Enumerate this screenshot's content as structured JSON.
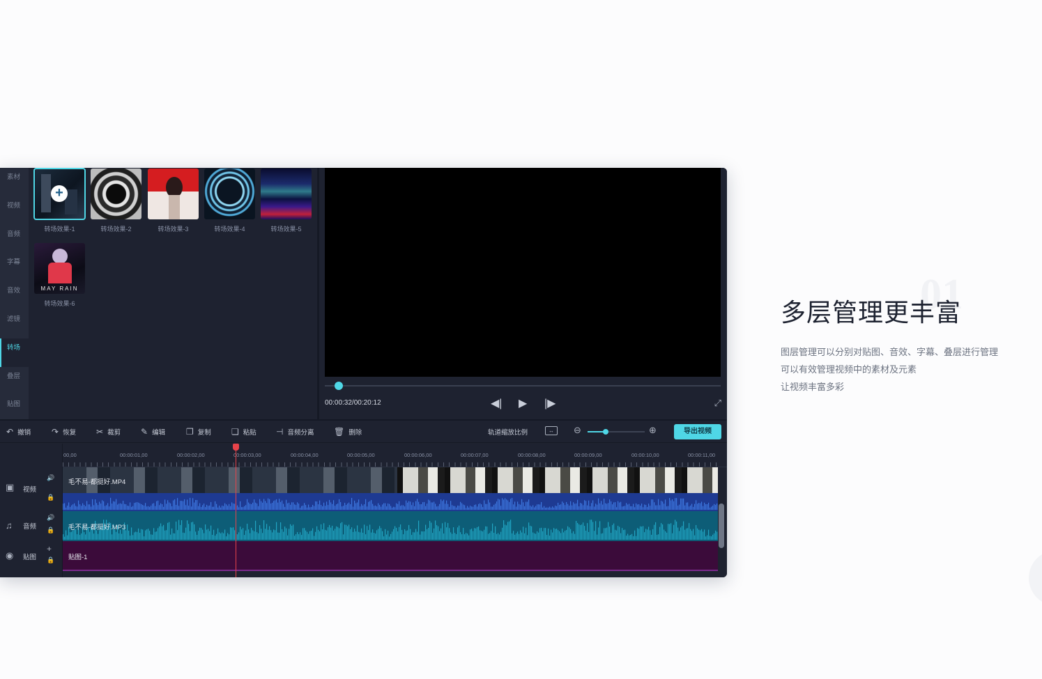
{
  "sidebar": {
    "items": [
      {
        "label": "素材"
      },
      {
        "label": "视频"
      },
      {
        "label": "音频"
      },
      {
        "label": "字幕"
      },
      {
        "label": "音效"
      },
      {
        "label": "滤镜"
      },
      {
        "label": "转场",
        "active": true
      },
      {
        "label": "叠层"
      },
      {
        "label": "贴图"
      }
    ]
  },
  "library": {
    "items": [
      {
        "label": "转场效果-1",
        "selected": true
      },
      {
        "label": "转场效果-2"
      },
      {
        "label": "转场效果-3"
      },
      {
        "label": "转场效果-4"
      },
      {
        "label": "转场效果-5"
      },
      {
        "label": "转场效果-6",
        "image_text": "MAY RAIN"
      }
    ],
    "add_icon": "plus-circle-icon"
  },
  "preview": {
    "time": "00:00:32/00:20:12",
    "progress_fraction": 0.026,
    "controls": {
      "prev": "◀|",
      "play": "▶",
      "next": "|▶",
      "fullscreen": "⤢"
    }
  },
  "toolbar": {
    "undo": "撤销",
    "redo": "恢复",
    "cut": "裁剪",
    "edit": "编辑",
    "copy": "复制",
    "paste": "粘贴",
    "split_audio": "音频分离",
    "delete": "删除",
    "zoom_label": "轨道缩放比例",
    "zoom_fraction": 0.32,
    "export": "导出视频"
  },
  "timeline": {
    "ruler_labels": [
      "00,00",
      "00:00:01,00",
      "00:00:02,00",
      "00:00:03,00",
      "00:00:04,00",
      "00:00:05,00",
      "00:00:06,00",
      "00:00:07,00",
      "00:00:08,00",
      "00:00:09,00",
      "00:00:10,00",
      "00:00:11,00"
    ],
    "tracks": [
      {
        "name": "视频",
        "clip": "毛不易-都挺好.MP4"
      },
      {
        "name": "音频",
        "clip": "毛不易-都挺好.MP3"
      },
      {
        "name": "贴图",
        "clip": "贴图-1"
      }
    ],
    "playhead_time": "00:00:03,00"
  },
  "hero": {
    "number": "01",
    "title": "多层管理更丰富",
    "desc_lines": [
      "图层管理可以分别对贴图、音效、字幕、叠层进行管理",
      "可以有效管理视频中的素材及元素",
      "让视频丰富多彩"
    ]
  },
  "colors": {
    "accent": "#4fd7e6",
    "playhead": "#e8434a",
    "panel": "#1e2230"
  }
}
